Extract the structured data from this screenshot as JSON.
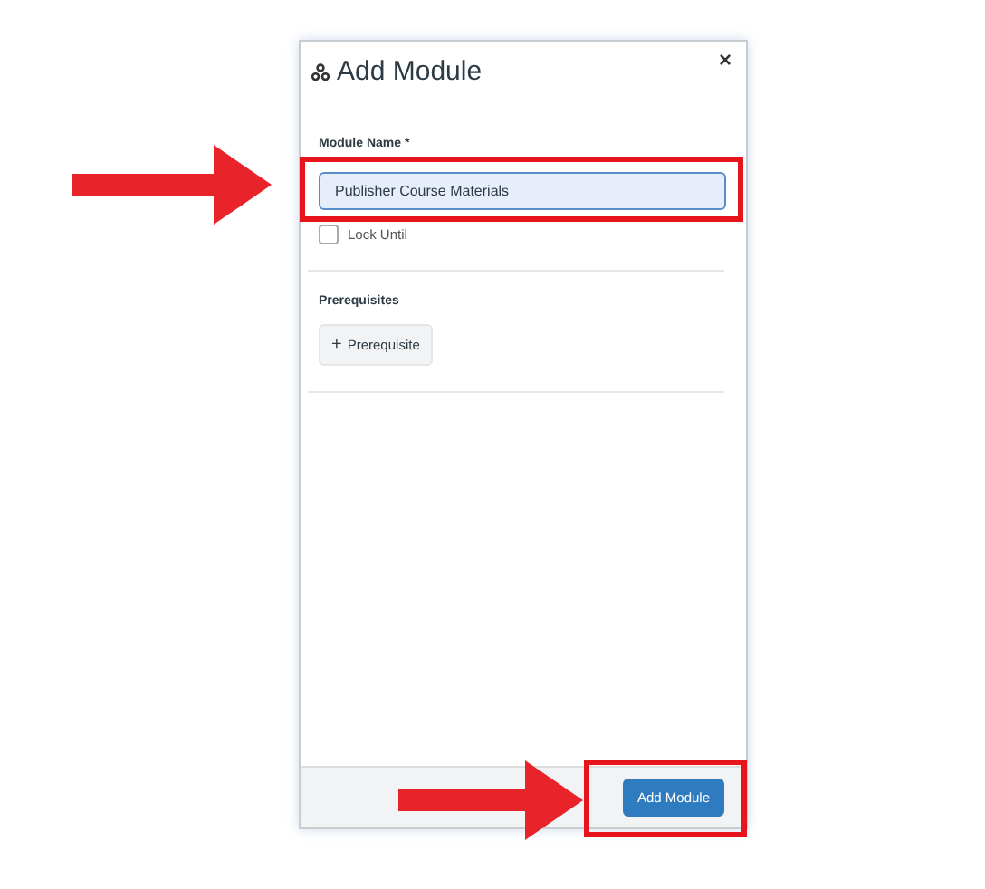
{
  "dialog": {
    "title": "Add Module",
    "close": "×",
    "module_name": {
      "label": "Module Name *",
      "value": "Publisher Course Materials"
    },
    "lock_until": {
      "label": "Lock Until",
      "checked": false
    },
    "prerequisites": {
      "heading": "Prerequisites",
      "button": "Prerequisite",
      "button_icon": "+"
    },
    "footer_button": "Add Module"
  }
}
